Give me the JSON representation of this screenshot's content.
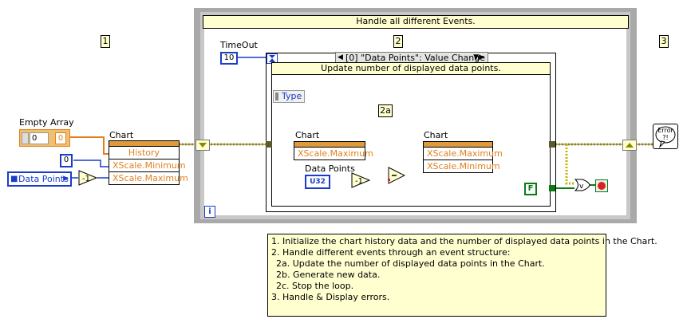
{
  "frames": {
    "frame1_number": "1",
    "frame2_number": "2",
    "frame3_number": "3",
    "event_subframe": "2a"
  },
  "init": {
    "empty_array_label": "Empty Array",
    "array_index": "0",
    "array_element": "0",
    "xscale_min_const": "0",
    "data_points_control": "Data Points",
    "chart_label": "Chart",
    "chart_props": [
      "History",
      "XScale.Minimum",
      "XScale.Maximum"
    ]
  },
  "loop": {
    "header": "Handle all different Events.",
    "timeout_label": "TimeOut",
    "timeout_value": "10",
    "event_selector": "[0] \"Data Points\": Value Change",
    "event_description": "Update number of displayed data points.",
    "type_node": "Type",
    "chart_read_label": "Chart",
    "chart_read_prop": "XScale.Maximum",
    "chart_write_label": "Chart",
    "chart_write_props": [
      "XScale.Maximum",
      "XScale.Minimum"
    ],
    "data_points_local": "Data Points",
    "data_points_type": "U32",
    "false_const": "F",
    "iteration_terminal": "i"
  },
  "error": {
    "handler_text": "Error\n?!"
  },
  "notes": [
    "1. Initialize the chart history data and the number of displayed data points in the Chart.",
    "2. Handle different events through an event structure:",
    "  2a. Update the number of displayed data points in the Chart.",
    "  2b. Generate new data.",
    "  2c. Stop the loop.",
    "3. Handle & Display errors."
  ],
  "colors": {
    "error_wire": "#c8b400",
    "numeric_wire": "#1a3cc8",
    "array_wire": "#e0801e",
    "bool_wire": "#0a7a14",
    "frame_gray": "#a9a9a9",
    "note_bg": "#ffffd0"
  }
}
